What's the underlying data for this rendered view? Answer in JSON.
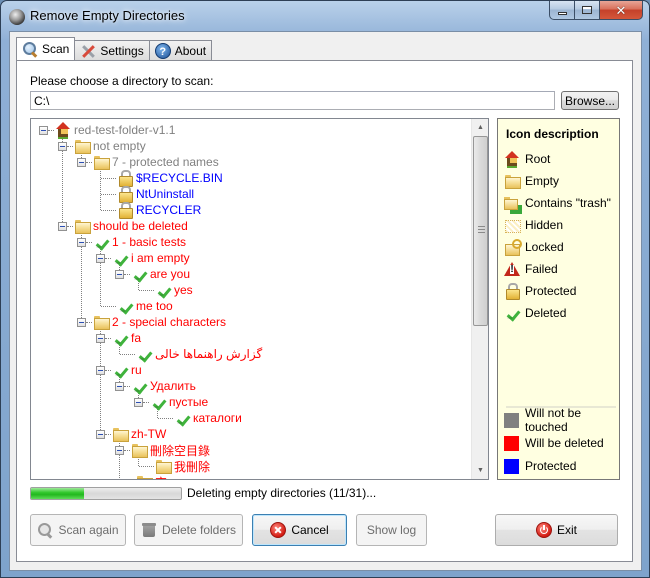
{
  "window": {
    "title": "Remove Empty Directories",
    "controls": {
      "minimize": "minimize",
      "maximize": "maximize",
      "close": "close"
    }
  },
  "tabs": [
    {
      "label": "Scan",
      "icon": "search-icon",
      "active": true
    },
    {
      "label": "Settings",
      "icon": "tools-icon",
      "active": false
    },
    {
      "label": "About",
      "icon": "help-icon",
      "active": false
    }
  ],
  "scan": {
    "choose_label": "Please choose a directory to scan:",
    "directory_value": "C:\\",
    "browse_label": "Browse..."
  },
  "tree": [
    {
      "label": "red-test-folder-v1.1",
      "icon": "root",
      "color": "gray",
      "level": 0
    },
    {
      "label": "not empty",
      "icon": "folder",
      "color": "gray",
      "level": 1
    },
    {
      "label": "7 - protected names",
      "icon": "folder",
      "color": "gray",
      "level": 2
    },
    {
      "label": "$RECYCLE.BIN",
      "icon": "lock",
      "color": "blue",
      "level": 3
    },
    {
      "label": "NtUninstall",
      "icon": "lock",
      "color": "blue",
      "level": 3
    },
    {
      "label": "RECYCLER",
      "icon": "lock",
      "color": "blue",
      "level": 3
    },
    {
      "label": "should be deleted",
      "icon": "folder",
      "color": "red",
      "level": 1
    },
    {
      "label": "1 - basic tests",
      "icon": "check",
      "color": "red",
      "level": 2
    },
    {
      "label": "i am empty",
      "icon": "check",
      "color": "red",
      "level": 3
    },
    {
      "label": "are you",
      "icon": "check",
      "color": "red",
      "level": 4
    },
    {
      "label": "yes",
      "icon": "check",
      "color": "red",
      "level": 5
    },
    {
      "label": "me too",
      "icon": "check",
      "color": "red",
      "level": 3
    },
    {
      "label": "2 - special characters",
      "icon": "folder",
      "color": "red",
      "level": 2
    },
    {
      "label": "fa",
      "icon": "check",
      "color": "red",
      "level": 3
    },
    {
      "label": "گزارش راهنماها خالی",
      "icon": "check",
      "color": "red",
      "level": 4
    },
    {
      "label": "ru",
      "icon": "check",
      "color": "red",
      "level": 3
    },
    {
      "label": "Удалить",
      "icon": "check",
      "color": "red",
      "level": 4
    },
    {
      "label": "пустые",
      "icon": "check",
      "color": "red",
      "level": 5
    },
    {
      "label": "каталоги",
      "icon": "check",
      "color": "red",
      "level": 6
    },
    {
      "label": "zh-TW",
      "icon": "folder",
      "color": "red",
      "level": 3
    },
    {
      "label": "刪除空目錄",
      "icon": "folder",
      "color": "red",
      "level": 4
    },
    {
      "label": "我刪除",
      "icon": "folder",
      "color": "red",
      "level": 5
    },
    {
      "label": "空",
      "icon": "folder",
      "color": "red",
      "level": 4
    }
  ],
  "legend": {
    "title": "Icon description",
    "icons": [
      {
        "label": "Root",
        "icon": "root"
      },
      {
        "label": "Empty",
        "icon": "folder"
      },
      {
        "label": "Contains \"trash\"",
        "icon": "trash"
      },
      {
        "label": "Hidden",
        "icon": "hidden"
      },
      {
        "label": "Locked",
        "icon": "locked-folder"
      },
      {
        "label": "Failed",
        "icon": "failed"
      },
      {
        "label": "Protected",
        "icon": "lock"
      },
      {
        "label": "Deleted",
        "icon": "check"
      }
    ],
    "colors": [
      {
        "label": "Will not be touched",
        "color": "#808080"
      },
      {
        "label": "Will be deleted",
        "color": "#ff0000"
      },
      {
        "label": "Protected",
        "color": "#0000ff"
      }
    ]
  },
  "colors": {
    "gray": "#808080",
    "red": "#ff0000",
    "blue": "#0000ff"
  },
  "progress": {
    "current": 11,
    "total": 31,
    "fraction": 0.355,
    "status_text": "Deleting empty directories (11/31)..."
  },
  "buttons": {
    "scan_again": {
      "label": "Scan again",
      "enabled": false
    },
    "delete_folders": {
      "label": "Delete folders",
      "enabled": false
    },
    "cancel": {
      "label": "Cancel",
      "enabled": true
    },
    "show_log": {
      "label": "Show log",
      "enabled": false
    },
    "exit": {
      "label": "Exit",
      "enabled": true
    }
  }
}
